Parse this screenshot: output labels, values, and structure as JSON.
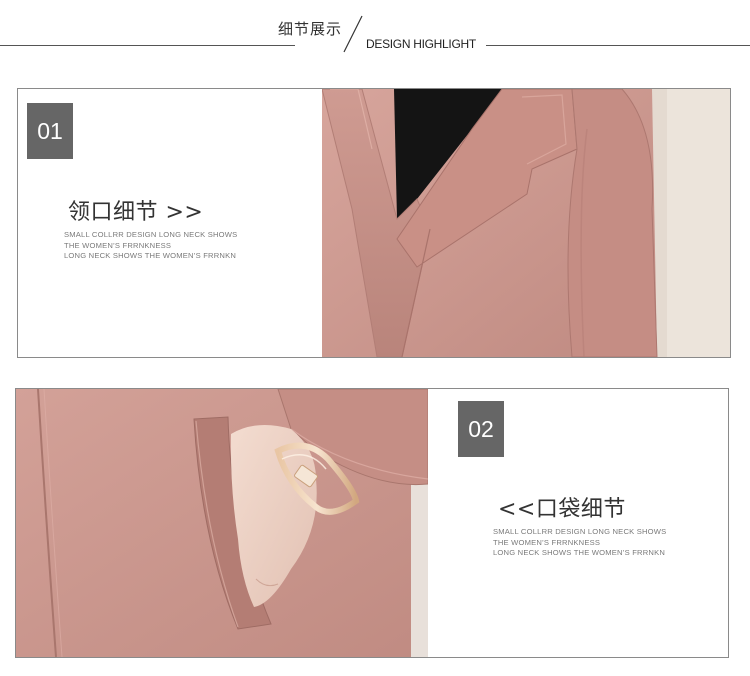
{
  "header": {
    "title_cn": "细节展示",
    "title_en": "DESIGN HIGHLIGHT"
  },
  "sections": [
    {
      "number": "01",
      "title": "领口细节 >>",
      "description": [
        "SMALL COLLRR DESIGN LONG NECK SHOWS",
        "THE WOMEN’S FRRNKNESS",
        "LONG NECK SHOWS THE WOMEN’S FRRNKN"
      ],
      "photo_subject": "collar-detail"
    },
    {
      "number": "02",
      "title": "<<口袋细节",
      "description": [
        "SMALL COLLRR DESIGN LONG NECK SHOWS",
        "THE WOMEN’S FRRNKNESS",
        "LONG NECK SHOWS THE WOMEN’S FRRNKN"
      ],
      "photo_subject": "pocket-detail"
    }
  ],
  "colors": {
    "coat_pink": "#c9958c",
    "number_box": "#666666",
    "frame_border": "#8a8a8a"
  }
}
